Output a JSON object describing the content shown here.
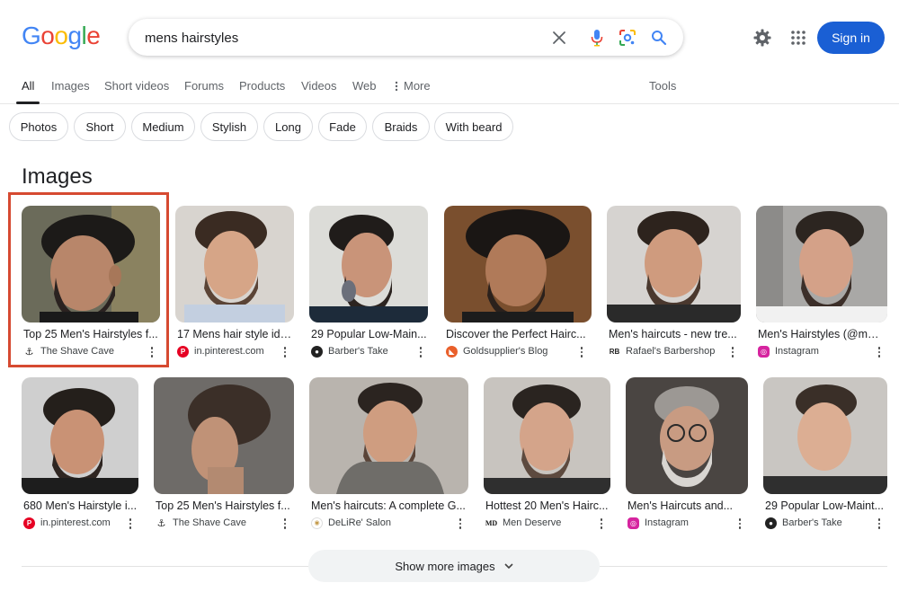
{
  "logo": {
    "letters": [
      {
        "ch": "G",
        "color": "#4285F4"
      },
      {
        "ch": "o",
        "color": "#EA4335"
      },
      {
        "ch": "o",
        "color": "#FBBC05"
      },
      {
        "ch": "g",
        "color": "#4285F4"
      },
      {
        "ch": "l",
        "color": "#34A853"
      },
      {
        "ch": "e",
        "color": "#EA4335"
      }
    ]
  },
  "search": {
    "query": "mens hairstyles",
    "icons": [
      "clear-icon",
      "microphone-icon",
      "lens-icon",
      "search-icon"
    ]
  },
  "header": {
    "settings_icon": "gear-icon",
    "apps_icon": "grid-icon",
    "signin_label": "Sign in"
  },
  "tabs": [
    {
      "label": "All"
    },
    {
      "label": "Images"
    },
    {
      "label": "Short videos"
    },
    {
      "label": "Forums"
    },
    {
      "label": "Products"
    },
    {
      "label": "Videos"
    },
    {
      "label": "Web"
    },
    {
      "label": "More"
    }
  ],
  "tools_label": "Tools",
  "chips": [
    {
      "label": "Photos"
    },
    {
      "label": "Short"
    },
    {
      "label": "Medium"
    },
    {
      "label": "Stylish"
    },
    {
      "label": "Long"
    },
    {
      "label": "Fade"
    },
    {
      "label": "Braids"
    },
    {
      "label": "With beard"
    }
  ],
  "images_section": {
    "title": "Images",
    "row1": [
      {
        "title": "Top 25 Men's Hairstyles f...",
        "source": "The Shave Cave",
        "favicon": "anchor-icon"
      },
      {
        "title": "17 Mens hair style ide...",
        "source": "in.pinterest.com",
        "favicon": "pinterest-icon"
      },
      {
        "title": "29 Popular Low-Main...",
        "source": "Barber's Take",
        "favicon": "barberstake-icon"
      },
      {
        "title": "Discover the Perfect Hairc...",
        "source": "Goldsupplier's Blog",
        "favicon": "goldsupplier-icon"
      },
      {
        "title": "Men's haircuts - new tre...",
        "source": "Rafael's Barbershop",
        "favicon": "rb-icon"
      },
      {
        "title": "Men's Hairstyles (@me...",
        "source": "Instagram",
        "favicon": "instagram-icon"
      }
    ],
    "row2": [
      {
        "title": "680 Men's Hairstyle i...",
        "source": "in.pinterest.com",
        "favicon": "pinterest-icon"
      },
      {
        "title": "Top 25 Men's Hairstyles f...",
        "source": "The Shave Cave",
        "favicon": "anchor-icon"
      },
      {
        "title": "Men's haircuts: A complete G...",
        "source": "DeLiRe' Salon",
        "favicon": "delire-icon"
      },
      {
        "title": "Hottest 20 Men's Hairc...",
        "source": "Men Deserve",
        "favicon": "md-icon"
      },
      {
        "title": "Men's Haircuts and...",
        "source": "Instagram",
        "favicon": "instagram-icon"
      },
      {
        "title": "29 Popular Low-Maint...",
        "source": "Barber's Take",
        "favicon": "barberstake-icon"
      }
    ]
  },
  "show_more_label": "Show more images",
  "colors": {
    "accent_blue": "#1a5fd4",
    "highlight_red": "#d64a31",
    "pinterest_red": "#e60023",
    "instagram": "#d6249f"
  }
}
